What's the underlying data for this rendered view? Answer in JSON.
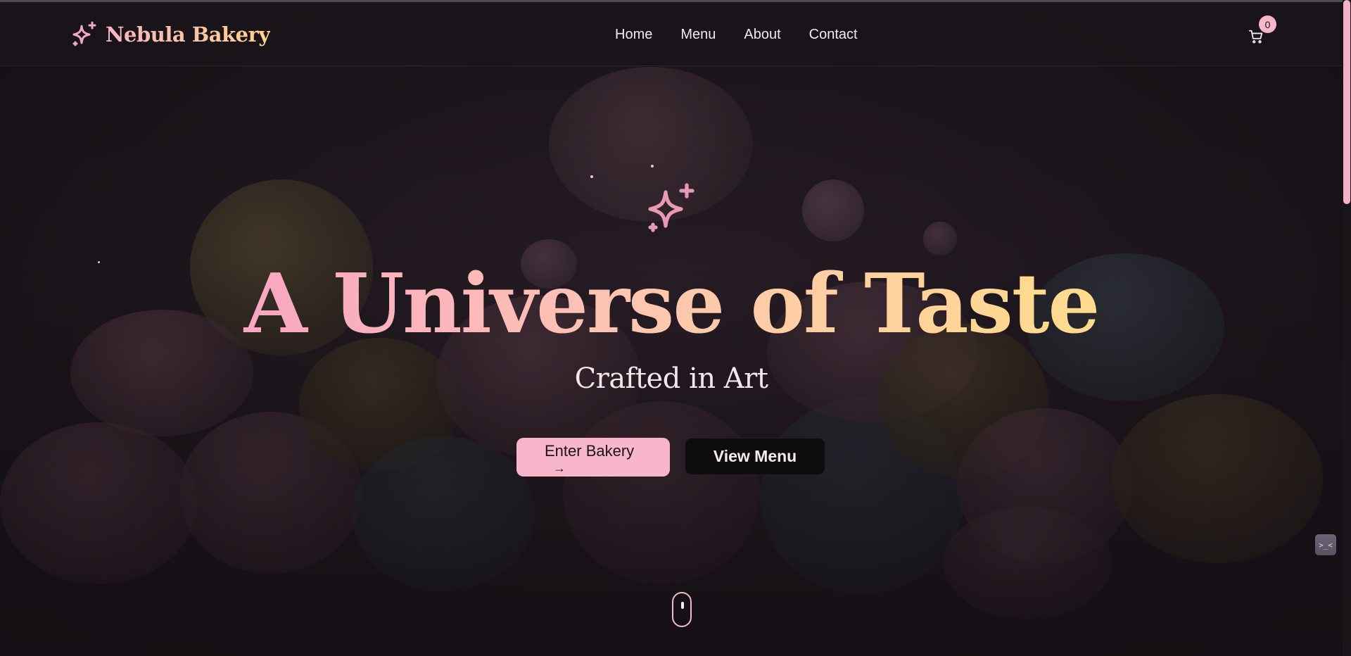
{
  "brand": {
    "name": "Nebula Bakery",
    "icon": "sparkles-icon"
  },
  "nav": {
    "links": [
      "Home",
      "Menu",
      "About",
      "Contact"
    ]
  },
  "cart": {
    "icon": "cart-icon",
    "count": "0"
  },
  "hero": {
    "icon": "sparkles-icon",
    "title": "A Universe of Taste",
    "subtitle": "Crafted in Art",
    "primary_button": "Enter Bakery",
    "primary_button_icon": "→",
    "secondary_button": "View Menu",
    "scroll_indicator_icon": "mouse-icon"
  },
  "widget": {
    "icon": "terminal-icon",
    "glyph": ">_<"
  },
  "colors": {
    "accent_pink": "#f8b6ca",
    "accent_gold": "#ffd98c",
    "background": "#171217"
  }
}
